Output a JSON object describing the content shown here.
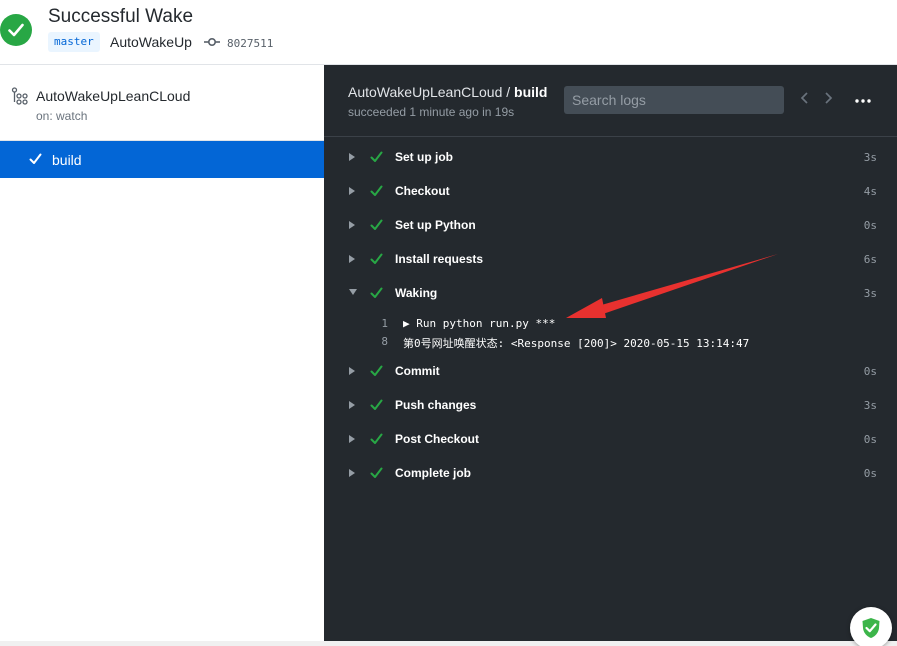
{
  "header": {
    "title": "Successful Wake",
    "branch": "master",
    "repo": "AutoWakeUp",
    "commit": "8027511"
  },
  "sidebar": {
    "workflow_name": "AutoWakeUpLeanCLoud",
    "trigger": "on: watch",
    "jobs": [
      {
        "label": "build",
        "selected": true
      }
    ]
  },
  "log": {
    "breadcrumb_prefix": "AutoWakeUpLeanCLoud / ",
    "job_name": "build",
    "status": "succeeded 1 minute ago in 19s",
    "search_placeholder": "Search logs",
    "steps": [
      {
        "name": "Set up job",
        "duration": "3s",
        "expanded": false
      },
      {
        "name": "Checkout",
        "duration": "4s",
        "expanded": false
      },
      {
        "name": "Set up Python",
        "duration": "0s",
        "expanded": false
      },
      {
        "name": "Install requests",
        "duration": "6s",
        "expanded": false
      },
      {
        "name": "Waking",
        "duration": "3s",
        "expanded": true
      },
      {
        "name": "Commit",
        "duration": "0s",
        "expanded": false
      },
      {
        "name": "Push changes",
        "duration": "3s",
        "expanded": false
      },
      {
        "name": "Post Checkout",
        "duration": "0s",
        "expanded": false
      },
      {
        "name": "Complete job",
        "duration": "0s",
        "expanded": false
      }
    ],
    "waking_lines": [
      {
        "num": "1",
        "text": "▶ Run python run.py ***"
      },
      {
        "num": "8",
        "text": "第0号网址唤醒状态: <Response [200]> 2020-05-15 13:14:47"
      }
    ]
  },
  "colors": {
    "success": "#28a745",
    "selected": "#0366d6",
    "panel_bg": "#24292e",
    "annotation_arrow": "#e8312f"
  }
}
